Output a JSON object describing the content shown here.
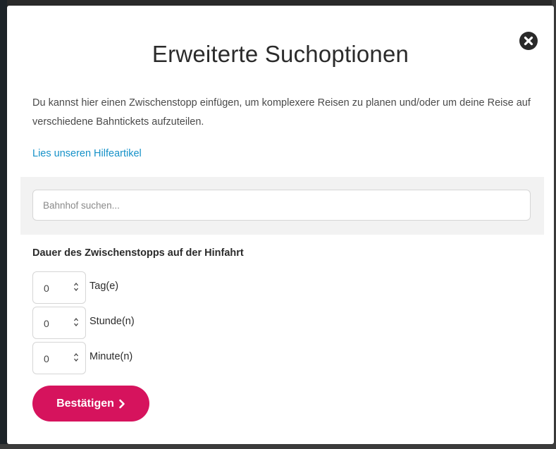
{
  "modal": {
    "title": "Erweiterte Suchoptionen",
    "close_icon": "close-circle-icon",
    "description": "Du kannst hier einen Zwischenstopp einfügen, um komplexere Reisen zu planen und/oder um deine Reise auf verschiedene Bahntickets aufzuteilen.",
    "help_link": "Lies unseren Hilfeartikel"
  },
  "search": {
    "placeholder": "Bahnhof suchen...",
    "value": ""
  },
  "duration": {
    "heading": "Dauer des Zwischenstopps auf der Hinfahrt",
    "rows": [
      {
        "value": "0",
        "label": "Tag(e)"
      },
      {
        "value": "0",
        "label": "Stunde(n)"
      },
      {
        "value": "0",
        "label": "Minute(n)"
      }
    ]
  },
  "confirm": {
    "label": "Bestätigen",
    "icon": "chevron-right-icon"
  },
  "colors": {
    "accent": "#d6135d",
    "link": "#1591c8",
    "panel": "#f2f2f2"
  }
}
